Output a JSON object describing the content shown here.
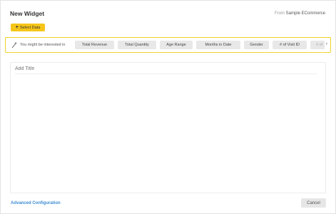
{
  "header": {
    "title": "New Widget",
    "source_prefix": "From",
    "source_name": "Sample ECommerce"
  },
  "toolbar": {
    "select_data_label": "Select Data"
  },
  "suggestions": {
    "lead_text": "You might be interested in",
    "items": [
      "Total Revenue",
      "Total Quantity",
      "Age Range",
      "Months in Date",
      "Gender",
      "# of Visit ID",
      "# of"
    ]
  },
  "main": {
    "title_placeholder": "Add Title"
  },
  "footer": {
    "advanced_label": "Advanced Configuration",
    "cancel_label": "Cancel"
  },
  "icons": {
    "select": "plus-icon",
    "suggest": "magic-wand-icon",
    "scroll": "chevron-right-icon"
  },
  "colors": {
    "accent": "#f5c518",
    "highlight_border": "#f2d12e",
    "link": "#3d8ed4"
  }
}
